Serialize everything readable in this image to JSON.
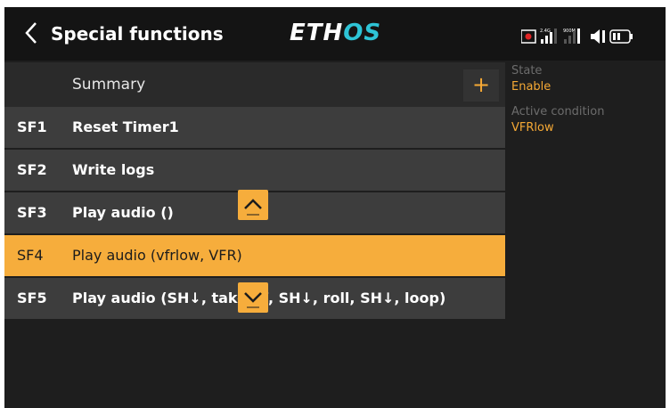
{
  "header": {
    "back_icon": "chevron-left-icon",
    "title": "Special functions",
    "logo_main": "ETH",
    "logo_accent": "OS",
    "status_icons": [
      "rf-status-icon",
      "signal-2.4g-icon",
      "signal-900m-icon",
      "speaker-icon",
      "battery-icon"
    ],
    "signal_24g_label": "2.4G",
    "signal_900m_label": "900M"
  },
  "list": {
    "summary_label": "Summary",
    "add_label": "+",
    "rows": [
      {
        "code": "SF1",
        "name": "Reset Timer1"
      },
      {
        "code": "SF2",
        "name": "Write logs"
      },
      {
        "code": "SF3",
        "name": "Play audio ()"
      },
      {
        "code": "SF4",
        "name": "Play audio (vfrlow, VFR)",
        "selected": true
      },
      {
        "code": "SF5",
        "name": "Play audio (SH↓, takeoff, SH↓, roll, SH↓, loop)"
      }
    ]
  },
  "scroll": {
    "up_icon": "chevron-up-icon",
    "down_icon": "chevron-down-icon"
  },
  "properties": {
    "state_label": "State",
    "state_value": "Enable",
    "condition_label": "Active condition",
    "condition_value": "VFRlow"
  },
  "colors": {
    "accent": "#f6ad3c",
    "logo_accent": "#2ec4d6",
    "background": "#1e1e1e",
    "row": "#3d3d3d"
  }
}
